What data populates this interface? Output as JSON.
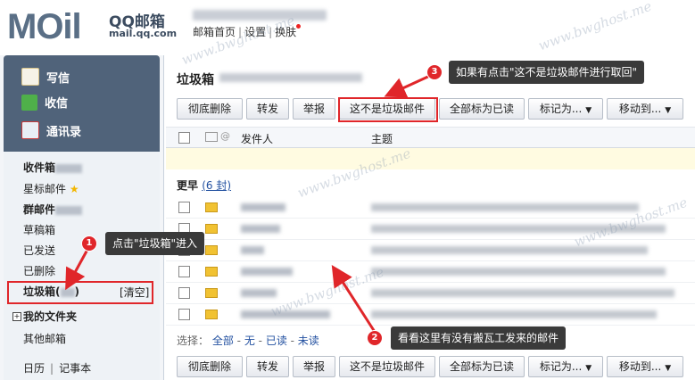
{
  "header": {
    "logo": "MOil",
    "brand": "QQ邮箱",
    "domain": "mail.qq.com",
    "nav": [
      "邮箱首页",
      "设置",
      "换肤"
    ]
  },
  "sidebar": {
    "actions": [
      {
        "label": "写信",
        "icon": "compose-icon"
      },
      {
        "label": "收信",
        "icon": "inbox-download-icon"
      },
      {
        "label": "通讯录",
        "icon": "contacts-icon"
      }
    ],
    "folders": [
      "收件箱",
      "星标邮件",
      "群邮件",
      "草稿箱",
      "已发送",
      "已删除",
      "垃圾箱",
      "我的文件夹",
      "其他邮箱"
    ],
    "star_glyph": "★",
    "trash_clear": "[清空]",
    "bottom": [
      "日历",
      "记事本"
    ]
  },
  "main": {
    "title": "垃圾箱",
    "toolbar": [
      "彻底删除",
      "转发",
      "举报",
      "这不是垃圾邮件",
      "全部标为已读",
      "标记为...",
      "移动到..."
    ],
    "columns": [
      "发件人",
      "主题"
    ],
    "section_label": "更早",
    "section_count": "(6 封)",
    "select_prefix": "选择：",
    "select_options": [
      "全部",
      "无",
      "已读",
      "未读"
    ]
  },
  "callouts": [
    {
      "num": "1",
      "text": "点击\"垃圾箱\"进入"
    },
    {
      "num": "2",
      "text": "看看这里有没有搬瓦工发来的邮件"
    },
    {
      "num": "3",
      "text": "如果有点击\"这不是垃圾邮件进行取回\""
    }
  ],
  "watermark": "www.bwghost.me",
  "colors": {
    "sidebar": "#50637a",
    "highlight": "#e0262a",
    "link": "#2250a0",
    "callout": "#3a3a3a"
  }
}
